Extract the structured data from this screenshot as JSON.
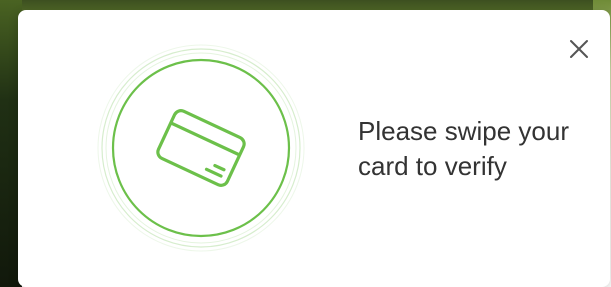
{
  "dialog": {
    "message_line1": "Please swipe your",
    "message_line2": "card to verify"
  },
  "icons": {
    "close": "close-icon",
    "card": "credit-card-icon"
  },
  "colors": {
    "accent_green": "#6cc04a",
    "text": "#333333",
    "close_icon": "#555555"
  }
}
